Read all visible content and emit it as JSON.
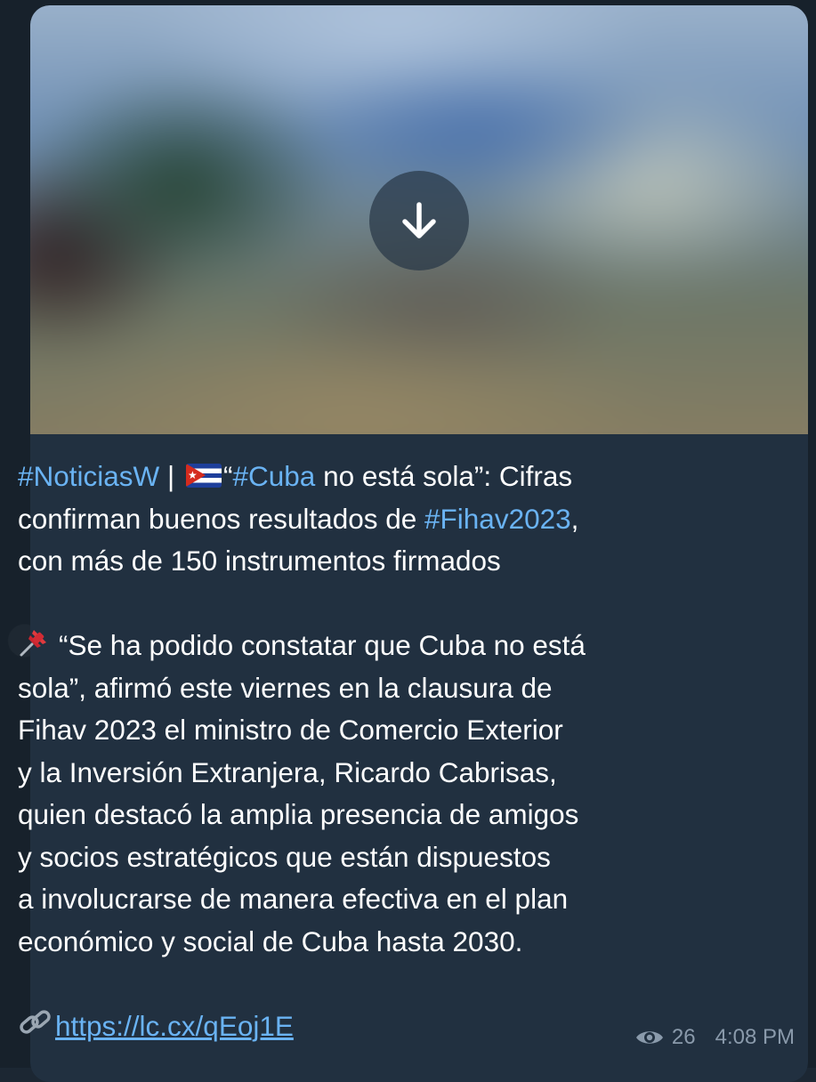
{
  "media": {
    "action": "download",
    "icon": "arrow-down-icon"
  },
  "message": {
    "headline": {
      "hashtag_noticias": "#NoticiasW",
      "separator": " | ",
      "flag_emoji": "🇨🇺",
      "quote_open": "“",
      "hashtag_cuba": "#Cuba",
      "headline_rest": " no está sola”: Cifras",
      "line2_text": "confirman buenos resultados de ",
      "hashtag_fihav": "#Fihav2023",
      "line2_tail": ",",
      "line3_text": "con más de 150 instrumentos firmados"
    },
    "body": {
      "pin_emoji": "📌",
      "lines": [
        "“Se ha podido constatar que Cuba no está",
        "sola”, afirmó este viernes en la clausura de",
        "Fihav 2023 el ministro de Comercio Exterior",
        "y la Inversión Extranjera, Ricardo Cabrisas,",
        "quien destacó la amplia presencia de amigos",
        "y socios estratégicos que están dispuestos",
        "a involucrarse de manera efectiva en el plan",
        "económico y social de Cuba hasta 2030."
      ]
    },
    "link": {
      "icon": "link-icon",
      "url": "https://lc.cx/qEoj1E"
    }
  },
  "meta": {
    "views_icon": "eye-icon",
    "views": "26",
    "time": "4:08 PM"
  },
  "colors": {
    "background": "#17212b",
    "bubble": "#213040",
    "link": "#6ab3f3",
    "text": "#ffffff",
    "meta": "#8a9aab"
  }
}
